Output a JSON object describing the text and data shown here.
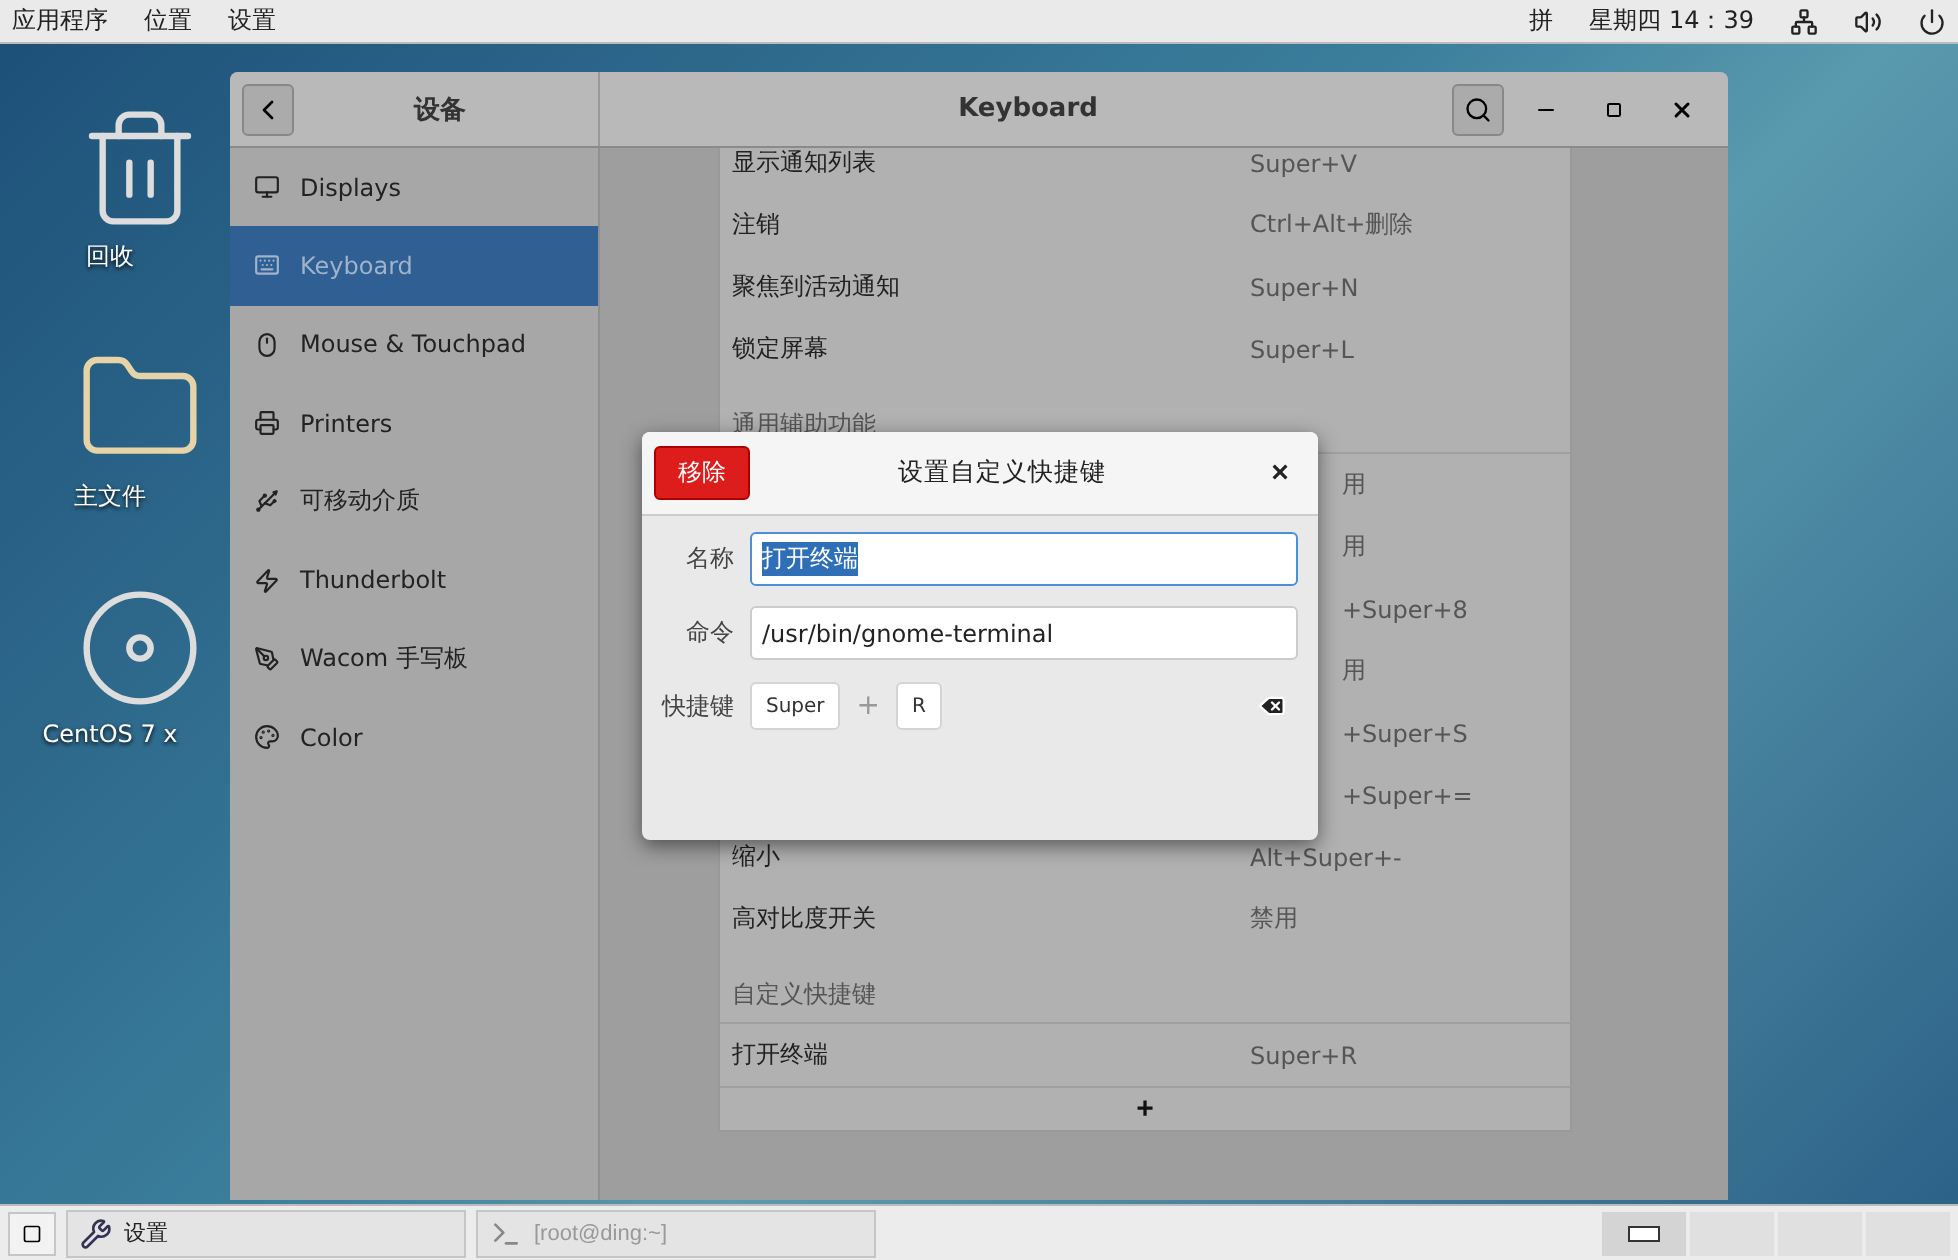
{
  "top_bar": {
    "menus": [
      "应用程序",
      "位置",
      "设置"
    ],
    "input_method": "拼",
    "clock": "星期四 14：39"
  },
  "desktop_icons": [
    {
      "kind": "trash",
      "label": "回收"
    },
    {
      "kind": "folder",
      "label": "主文件"
    },
    {
      "kind": "disc",
      "label": "CentOS 7 x"
    }
  ],
  "window": {
    "sidebar_title": "设备",
    "title": "Keyboard"
  },
  "sidebar": {
    "items": [
      {
        "kind": "display",
        "label": "Displays",
        "selected": false
      },
      {
        "kind": "keyboard",
        "label": "Keyboard",
        "selected": true
      },
      {
        "kind": "mouse",
        "label": "Mouse & Touchpad",
        "selected": false
      },
      {
        "kind": "printer",
        "label": "Printers",
        "selected": false
      },
      {
        "kind": "usb",
        "label": "可移动介质",
        "selected": false
      },
      {
        "kind": "bolt",
        "label": "Thunderbolt",
        "selected": false
      },
      {
        "kind": "tablet",
        "label": "Wacom 手写板",
        "selected": false
      },
      {
        "kind": "color",
        "label": "Color",
        "selected": false
      }
    ]
  },
  "shortcuts": [
    {
      "kind": "row",
      "name": "显示通知列表",
      "value": "Super+V"
    },
    {
      "kind": "row",
      "name": "注销",
      "value": "Ctrl+Alt+删除"
    },
    {
      "kind": "row",
      "name": "聚焦到活动通知",
      "value": "Super+N"
    },
    {
      "kind": "row",
      "name": "锁定屏幕",
      "value": "Super+L"
    },
    {
      "kind": "header",
      "name": "通用辅助功能"
    },
    {
      "kind": "partial",
      "value": "用"
    },
    {
      "kind": "partial",
      "value": "用"
    },
    {
      "kind": "partial",
      "value": "+Super+8"
    },
    {
      "kind": "partial",
      "value": "用"
    },
    {
      "kind": "partial",
      "value": "+Super+S"
    },
    {
      "kind": "partial",
      "value": "+Super+="
    },
    {
      "kind": "row",
      "name": "缩小",
      "value": "Alt+Super+-"
    },
    {
      "kind": "row",
      "name": "高对比度开关",
      "value": "禁用"
    },
    {
      "kind": "header",
      "name": "自定义快捷键"
    },
    {
      "kind": "row",
      "name": "打开终端",
      "value": "Super+R"
    }
  ],
  "add_button": "+",
  "dialog": {
    "remove": "移除",
    "title": "设置自定义快捷键",
    "close": "×",
    "fields": [
      {
        "label": "名称",
        "value": "打开终端",
        "selected": true
      },
      {
        "label": "命令",
        "value": "/usr/bin/gnome-terminal",
        "selected": false
      }
    ],
    "shortcut_label": "快捷键",
    "keys": [
      "Super",
      "R"
    ],
    "plus": "+"
  },
  "taskbar": {
    "tasks": [
      {
        "kind": "settings",
        "label": "设置"
      },
      {
        "kind": "terminal",
        "label": "[root@ding:~]"
      }
    ],
    "workspaces": [
      {
        "selected": true
      },
      {
        "selected": false
      },
      {
        "selected": false
      },
      {
        "selected": false
      }
    ]
  }
}
